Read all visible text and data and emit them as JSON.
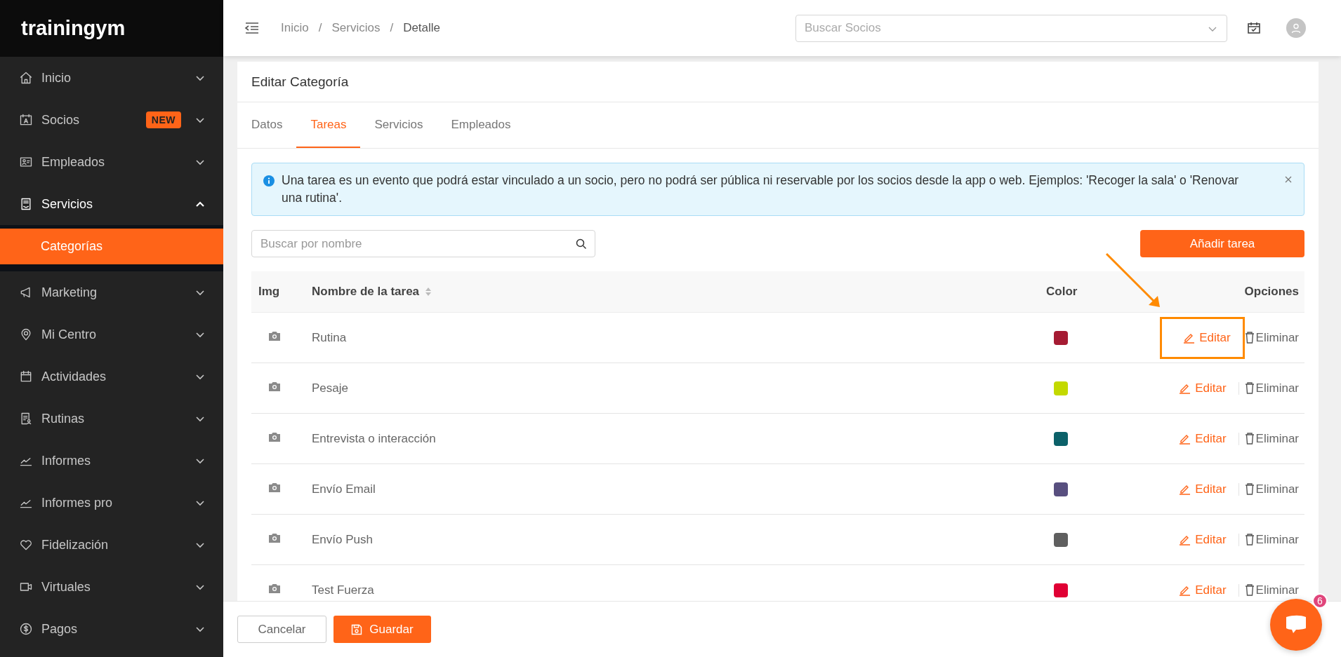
{
  "sidebar": {
    "logo": "trainingym",
    "items": [
      {
        "label": "Inicio",
        "expanded": false
      },
      {
        "label": "Socios",
        "badge": "NEW",
        "expanded": false
      },
      {
        "label": "Empleados",
        "expanded": false
      },
      {
        "label": "Servicios",
        "expanded": true,
        "children": [
          {
            "label": "Categorías",
            "selected": true
          }
        ]
      },
      {
        "label": "Marketing",
        "expanded": false
      },
      {
        "label": "Mi Centro",
        "expanded": false
      },
      {
        "label": "Actividades",
        "expanded": false
      },
      {
        "label": "Rutinas",
        "expanded": false
      },
      {
        "label": "Informes",
        "expanded": false
      },
      {
        "label": "Informes pro",
        "expanded": false
      },
      {
        "label": "Fidelización",
        "expanded": false
      },
      {
        "label": "Virtuales",
        "expanded": false
      },
      {
        "label": "Pagos",
        "expanded": false
      }
    ]
  },
  "topbar": {
    "breadcrumb": [
      "Inicio",
      "Servicios",
      "Detalle"
    ],
    "separator": "/",
    "search": {
      "placeholder": "Buscar Socios"
    }
  },
  "card": {
    "title": "Editar Categoría",
    "tabs": [
      {
        "label": "Datos",
        "selected": false
      },
      {
        "label": "Tareas",
        "selected": true
      },
      {
        "label": "Servicios",
        "selected": false
      },
      {
        "label": "Empleados",
        "selected": false
      }
    ],
    "alert": {
      "text": "Una tarea es un evento que podrá estar vinculado a un socio, pero no podrá ser pública ni reservable por los socios desde la app o web. Ejemplos: 'Recoger la sala' o 'Renovar una rutina'."
    },
    "search": {
      "placeholder": "Buscar por nombre"
    },
    "add_button": "Añadir tarea",
    "table": {
      "columns": [
        {
          "label": "Img",
          "sortable": false
        },
        {
          "label": "Nombre de la tarea",
          "sortable": true
        },
        {
          "label": "Color",
          "sortable": false
        },
        {
          "label": "Opciones",
          "sortable": false
        }
      ],
      "rows": [
        {
          "name": "Rutina",
          "color": "#a51b33",
          "edit": "Editar",
          "delete": "Eliminar",
          "highlighted": true
        },
        {
          "name": "Pesaje",
          "color": "#c3d900",
          "edit": "Editar",
          "delete": "Eliminar",
          "highlighted": false
        },
        {
          "name": "Entrevista o interacción",
          "color": "#0c6169",
          "edit": "Editar",
          "delete": "Eliminar",
          "highlighted": false
        },
        {
          "name": "Envío Email",
          "color": "#584f7f",
          "edit": "Editar",
          "delete": "Eliminar",
          "highlighted": false
        },
        {
          "name": "Envío Push",
          "color": "#5f5f5f",
          "edit": "Editar",
          "delete": "Eliminar",
          "highlighted": false
        },
        {
          "name": "Test Fuerza",
          "color": "#e00034",
          "edit": "Editar",
          "delete": "Eliminar",
          "highlighted": false
        }
      ]
    }
  },
  "footer": {
    "cancel": "Cancelar",
    "save": "Guardar"
  },
  "chat": {
    "badge": "6"
  }
}
